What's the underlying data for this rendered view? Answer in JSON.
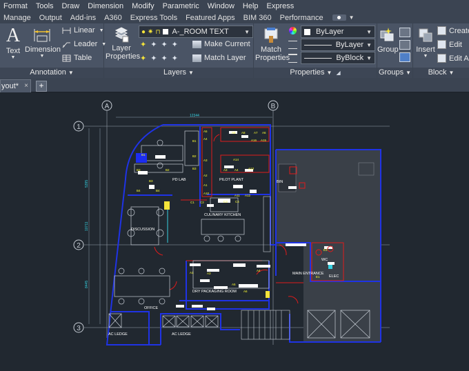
{
  "menu": [
    "Format",
    "Tools",
    "Draw",
    "Dimension",
    "Modify",
    "Parametric",
    "Window",
    "Help",
    "Express"
  ],
  "ribbon_tabs": [
    "Manage",
    "Output",
    "Add-ins",
    "A360",
    "Express Tools",
    "Featured Apps",
    "BIM 360",
    "Performance"
  ],
  "annotation": {
    "text": "Text",
    "dimension": "Dimension",
    "linear": "Linear",
    "leader": "Leader",
    "table": "Table",
    "title": "Annotation"
  },
  "layers": {
    "layer_properties_1": "Layer",
    "layer_properties_2": "Properties",
    "current_layer": "A-_ROOM TEXT",
    "make_current": "Make Current",
    "match_layer": "Match Layer",
    "title": "Layers"
  },
  "properties": {
    "match_1": "Match",
    "match_2": "Properties",
    "color": "ByLayer",
    "linetype": "ByLayer",
    "lineweight": "ByBlock",
    "title": "Properties"
  },
  "groups": {
    "group": "Group",
    "title": "Groups"
  },
  "block": {
    "insert": "Insert",
    "create": "Create",
    "edit": "Edit",
    "edit_attr": "Edit At",
    "title": "Block"
  },
  "doc_tab": {
    "label": "yout*",
    "close": "×",
    "new": "+"
  },
  "drawing": {
    "grid_cols": [
      "A",
      "B"
    ],
    "grid_rows": [
      "1",
      "2",
      "3"
    ],
    "rooms": [
      "PD LAB",
      "PILOT PLANT",
      "BIN",
      "DISCUSSION",
      "CULINARY KITCHEN",
      "MAIN ENTRANCE",
      "WC",
      "ELEC",
      "DRY PACKAGING ROOM",
      "OFFICE",
      "AC LEDGE",
      "AC LEDGE"
    ],
    "dims": [
      "12344",
      "5395",
      "10711",
      "8445"
    ],
    "labels": [
      "B1",
      "B2",
      "B3",
      "B4",
      "B4",
      "B3",
      "A5",
      "A4",
      "A3",
      "A2",
      "A1",
      "A10",
      "A11",
      "A12",
      "A9",
      "A8",
      "A7",
      "A6",
      "A14",
      "A13",
      "A16",
      "A15",
      "A3",
      "A4",
      "C1",
      "C2",
      "C3",
      "C4",
      "E3",
      "E1",
      "A5",
      "A6",
      "A1",
      "A3",
      "A4",
      "B1",
      "B2",
      "B3"
    ]
  },
  "colors": {
    "wall": "#1f33e6",
    "door": "#e01b1b",
    "equipment": "#ffffff",
    "label": "#ffff33",
    "background": "#212830",
    "ribbon": "#4a5465"
  }
}
